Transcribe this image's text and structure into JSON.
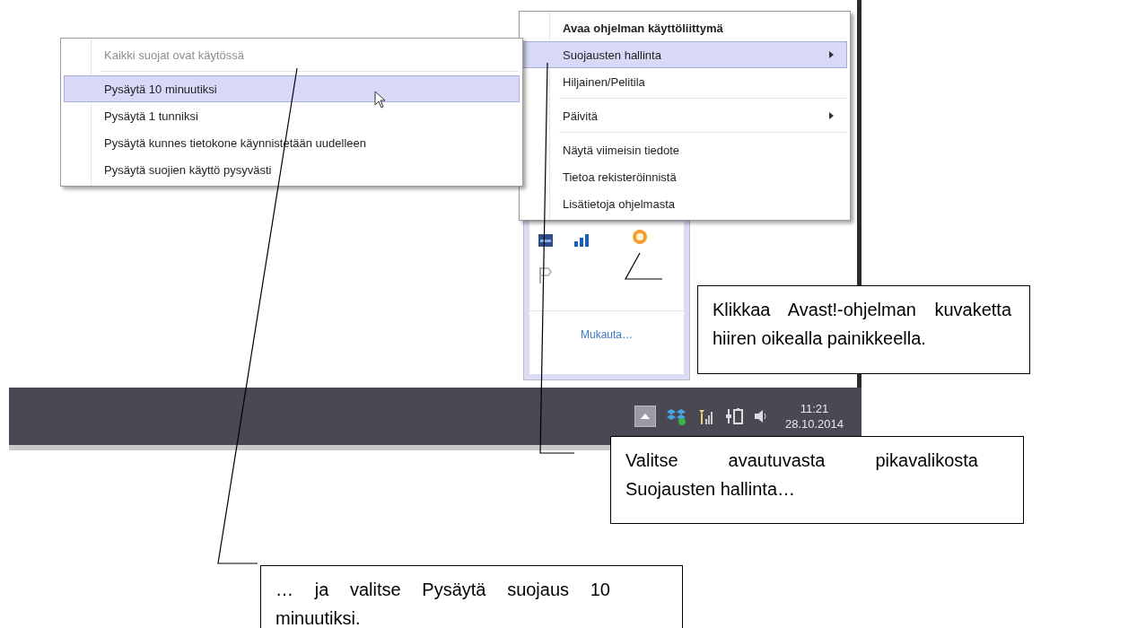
{
  "submenu": {
    "items": [
      {
        "label": "Kaikki suojat ovat käytössä",
        "disabled": true,
        "selected": false,
        "separator_after": true
      },
      {
        "label": "Pysäytä 10 minuutiksi",
        "disabled": false,
        "selected": true,
        "separator_after": false
      },
      {
        "label": "Pysäytä 1 tunniksi",
        "disabled": false,
        "selected": false,
        "separator_after": false
      },
      {
        "label": "Pysäytä kunnes tietokone käynnistetään uudelleen",
        "disabled": false,
        "selected": false,
        "separator_after": false
      },
      {
        "label": "Pysäytä suojien käyttö pysyvästi",
        "disabled": false,
        "selected": false,
        "separator_after": false
      }
    ]
  },
  "context_menu": {
    "items": [
      {
        "label": "Avaa ohjelman käyttöliittymä",
        "default": true,
        "selected": false,
        "has_submenu": false,
        "separator_after": false
      },
      {
        "label": "Suojausten hallinta",
        "default": false,
        "selected": true,
        "has_submenu": true,
        "separator_after": false
      },
      {
        "label": "Hiljainen/Pelitila",
        "default": false,
        "selected": false,
        "has_submenu": false,
        "separator_after": true
      },
      {
        "label": "Päivitä",
        "default": false,
        "selected": false,
        "has_submenu": true,
        "separator_after": true
      },
      {
        "label": "Näytä viimeisin tiedote",
        "default": false,
        "selected": false,
        "has_submenu": false,
        "separator_after": false
      },
      {
        "label": "Tietoa rekisteröinnistä",
        "default": false,
        "selected": false,
        "has_submenu": false,
        "separator_after": false
      },
      {
        "label": "Lisätietoja ohjelmasta",
        "default": false,
        "selected": false,
        "has_submenu": false,
        "separator_after": false
      }
    ]
  },
  "tray_popup": {
    "link": "Mukauta…"
  },
  "taskbar": {
    "time": "11:21",
    "date": "28.10.2014"
  },
  "callouts": [
    {
      "text": "Klikkaa Avast!-ohjelman kuvaketta hiiren oikealla painikkeella."
    },
    {
      "text": "Valitse avautuvasta pikavalikosta Suojausten hallinta…"
    },
    {
      "text": "… ja valitse Pysäytä suojaus 10 minuutiksi."
    }
  ]
}
